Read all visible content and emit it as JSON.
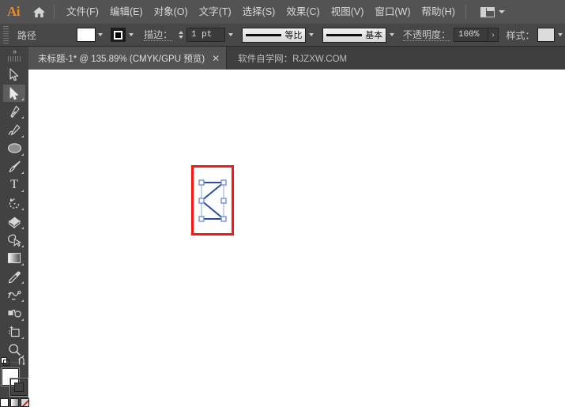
{
  "app": {
    "name": "Ai",
    "logo_color": "#ef8b22",
    "home_icon": "home-icon"
  },
  "menubar": {
    "items": [
      {
        "label": "文件(F)",
        "name": "file"
      },
      {
        "label": "编辑(E)",
        "name": "edit"
      },
      {
        "label": "对象(O)",
        "name": "object"
      },
      {
        "label": "文字(T)",
        "name": "type"
      },
      {
        "label": "选择(S)",
        "name": "select"
      },
      {
        "label": "效果(C)",
        "name": "effect"
      },
      {
        "label": "视图(V)",
        "name": "view"
      },
      {
        "label": "窗口(W)",
        "name": "window"
      },
      {
        "label": "帮助(H)",
        "name": "help"
      }
    ],
    "arrange_icon": "arrange-documents-icon",
    "arrange_caret": "chevron-down-icon"
  },
  "controlbar": {
    "selection_label": "路径",
    "fill_swatch": "#ffffff",
    "fill_caret": "chevron-down-icon",
    "stroke_swatch_icon": "stroke-color-icon",
    "stroke_caret": "chevron-down-icon",
    "stroke_label": "描边：",
    "stroke_weight": "1 pt",
    "stroke_weight_caret": "chevron-down-icon",
    "stroke_profile": "等比",
    "stroke_profile_caret": "chevron-down-icon",
    "brush_definition": "基本",
    "brush_caret": "chevron-down-icon",
    "opacity_label": "不透明度：",
    "opacity_value": "100%",
    "opacity_arrow": "›",
    "style_label": "样式：",
    "style_swatch": "#dcdcdc",
    "style_caret": "chevron-down-icon"
  },
  "tabbar": {
    "document_tab": "未标题-1* @ 135.89% (CMYK/GPU 预览)",
    "close_label": "✕",
    "watermark": "软件自学网：RJZXW.COM"
  },
  "toolpanel": {
    "collapse_label": "»",
    "tools": [
      {
        "name": "selection-tool",
        "label": "选择工具",
        "active": false
      },
      {
        "name": "direct-selection-tool",
        "label": "直接选择工具",
        "active": true
      },
      {
        "name": "pen-tool",
        "label": "钢笔工具",
        "active": false
      },
      {
        "name": "curvature-tool",
        "label": "曲率工具",
        "active": false
      },
      {
        "name": "ellipse-tool",
        "label": "椭圆工具",
        "active": false
      },
      {
        "name": "paintbrush-tool",
        "label": "画笔工具",
        "active": false
      },
      {
        "name": "type-tool",
        "label": "文字工具",
        "active": false
      },
      {
        "name": "rotate-tool",
        "label": "旋转工具",
        "active": false
      },
      {
        "name": "eraser-tool",
        "label": "橡皮擦工具",
        "active": false
      },
      {
        "name": "scale-tool",
        "label": "缩放工具",
        "active": false
      },
      {
        "name": "gradient-tool",
        "label": "渐变工具",
        "active": false
      },
      {
        "name": "eyedropper-tool",
        "label": "吸管工具",
        "active": false
      },
      {
        "name": "blend-tool",
        "label": "混合工具",
        "active": false
      },
      {
        "name": "symbol-sprayer-tool",
        "label": "符号喷枪工具",
        "active": false
      },
      {
        "name": "artboard-tool",
        "label": "画板工具",
        "active": false
      },
      {
        "name": "zoom-tool",
        "label": "缩放显示工具",
        "active": false
      }
    ],
    "fill_color": "#ffffff",
    "stroke_color": "#000000",
    "swap_icon": "swap-fill-stroke-icon",
    "default_icon": "default-fill-stroke-icon",
    "color_mode_buttons": [
      {
        "name": "color-mode-button",
        "label": "颜色"
      },
      {
        "name": "gradient-mode-button",
        "label": "渐变"
      },
      {
        "name": "none-mode-button",
        "label": "无"
      }
    ]
  },
  "canvas": {
    "background": "#ffffff",
    "artboard_border_color": "#ff1414",
    "path_stroke_color": "#2d4ea8",
    "anchor_fill": "#ffffff",
    "anchor_stroke": "#5d7fd6",
    "bbox_color": "#7f9ce0",
    "zoom_level": "135.89%"
  }
}
